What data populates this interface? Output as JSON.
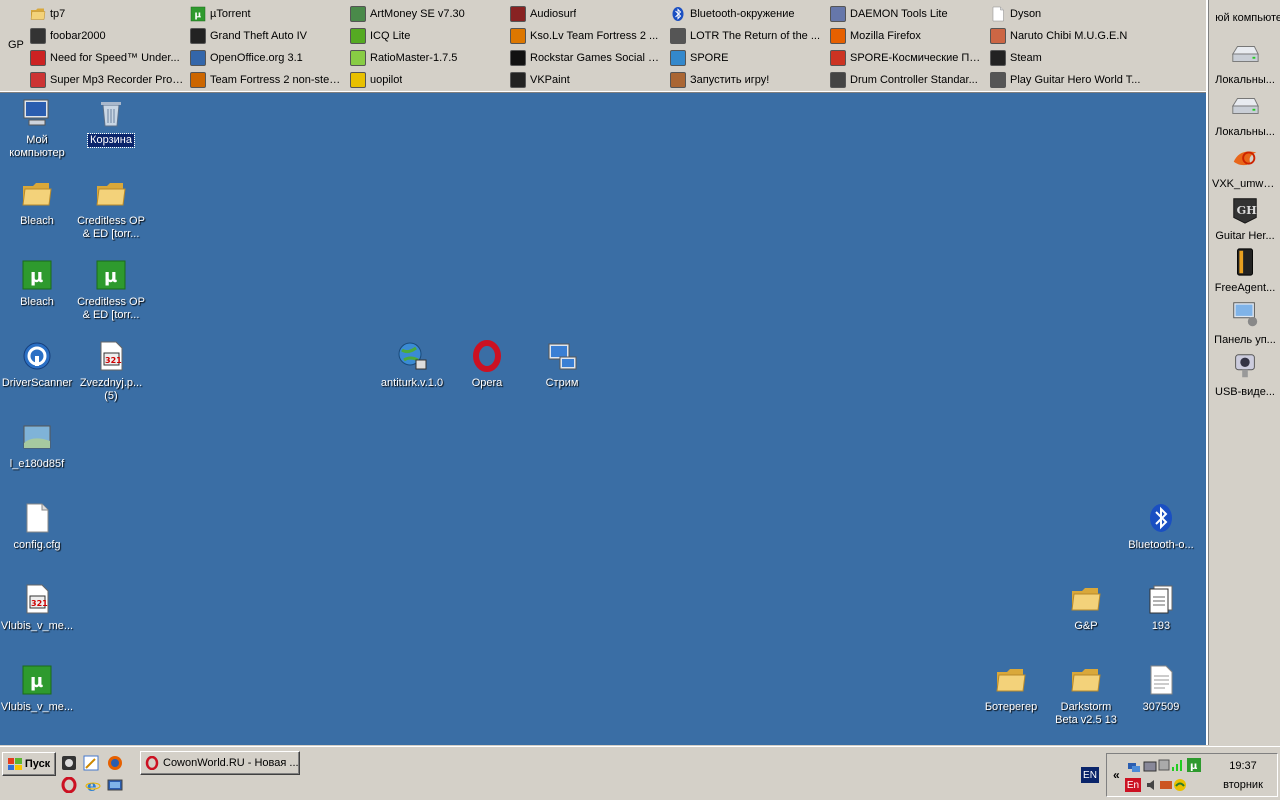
{
  "toolbar": {
    "gp_label": "GP",
    "items": [
      {
        "label": "tp7",
        "icon": "folder-icon",
        "color": "#e8c25a"
      },
      {
        "label": "foobar2000",
        "icon": "foobar-icon",
        "color": "#333333"
      },
      {
        "label": "Need for Speed™ Under...",
        "icon": "nfs-icon",
        "color": "#cc2222"
      },
      {
        "label": "Super Mp3 Recorder Prof...",
        "icon": "recorder-icon",
        "color": "#cc3333"
      },
      {
        "label": "µTorrent",
        "icon": "utorrent-icon",
        "color": "#2e9a2e"
      },
      {
        "label": "Grand Theft Auto IV",
        "icon": "gta-icon",
        "color": "#222222"
      },
      {
        "label": "OpenOffice.org 3.1",
        "icon": "openoffice-icon",
        "color": "#3366aa"
      },
      {
        "label": "Team Fortress 2 non-steam",
        "icon": "tf2-icon",
        "color": "#cc6600"
      },
      {
        "label": "ArtMoney SE v7.30",
        "icon": "artmoney-icon",
        "color": "#4a8a4a"
      },
      {
        "label": "ICQ Lite",
        "icon": "icq-icon",
        "color": "#55aa22"
      },
      {
        "label": "RatioMaster-1.7.5",
        "icon": "ratiomaster-icon",
        "color": "#88cc44"
      },
      {
        "label": "uopilot",
        "icon": "uopilot-icon",
        "color": "#e8c000"
      },
      {
        "label": "Audiosurf",
        "icon": "audiosurf-icon",
        "color": "#882222"
      },
      {
        "label": "Kso.Lv Team Fortress 2 ...",
        "icon": "halflife-icon",
        "color": "#dd7700"
      },
      {
        "label": "Rockstar Games Social Club",
        "icon": "rockstar-icon",
        "color": "#111111"
      },
      {
        "label": "VKPaint",
        "icon": "vkpaint-icon",
        "color": "#222222"
      },
      {
        "label": "Bluetooth-окружение",
        "icon": "bluetooth-icon",
        "color": "#1a4fc2"
      },
      {
        "label": "LOTR The Return of the ...",
        "icon": "lotr-icon",
        "color": "#555555"
      },
      {
        "label": "SPORE",
        "icon": "spore-icon",
        "color": "#3388cc"
      },
      {
        "label": "Запустить игру!",
        "icon": "game-icon",
        "color": "#aa6633"
      },
      {
        "label": "DAEMON Tools Lite",
        "icon": "daemon-icon",
        "color": "#6677aa"
      },
      {
        "label": "Mozilla Firefox",
        "icon": "firefox-icon",
        "color": "#e66000"
      },
      {
        "label": "SPORE-Космические Пр...",
        "icon": "spore-space-icon",
        "color": "#cc3322"
      },
      {
        "label": "Drum Controller Standar...",
        "icon": "drum-icon",
        "color": "#444444"
      },
      {
        "label": "Dyson",
        "icon": "file-icon",
        "color": "#ffffff"
      },
      {
        "label": "Naruto Chibi M.U.G.E.N",
        "icon": "naruto-icon",
        "color": "#cc6644"
      },
      {
        "label": "Steam",
        "icon": "steam-icon",
        "color": "#222222"
      },
      {
        "label": "Play Guitar Hero World T...",
        "icon": "guitarhero-icon",
        "color": "#555555"
      }
    ]
  },
  "rightbar": {
    "title": "юй компьюте",
    "items": [
      {
        "label": "Локальны...",
        "icon": "drive-icon"
      },
      {
        "label": "Локальны...",
        "icon": "drive-icon"
      },
      {
        "label": "VXK_umwx...",
        "icon": "flame-icon"
      },
      {
        "label": "Guitar Her...",
        "icon": "guitarhero-icon"
      },
      {
        "label": "FreeAgent...",
        "icon": "external-drive-icon"
      },
      {
        "label": "Панель уп...",
        "icon": "control-panel-icon"
      },
      {
        "label": "USB-виде...",
        "icon": "webcam-icon"
      }
    ]
  },
  "desktop": {
    "icons": [
      {
        "label": "Мой компьютер",
        "icon": "computer-icon"
      },
      {
        "label": "Корзина",
        "icon": "recycle-bin-icon"
      },
      {
        "label": "Bleach",
        "icon": "folder-icon"
      },
      {
        "label": "Creditless OP & ED [torr...",
        "icon": "folder-icon"
      },
      {
        "label": "Bleach",
        "icon": "utorrent-icon"
      },
      {
        "label": "Creditless OP & ED [torr...",
        "icon": "utorrent-icon"
      },
      {
        "label": "DriverScanner",
        "icon": "driverscanner-icon"
      },
      {
        "label": "Zvezdnyj.p... (5)",
        "icon": "media-file-icon"
      },
      {
        "label": "l_e180d85f",
        "icon": "image-file-icon"
      },
      {
        "label": "config.cfg",
        "icon": "file-icon"
      },
      {
        "label": "Vlubis_v_me...",
        "icon": "media-file-icon"
      },
      {
        "label": "Vlubis_v_me...",
        "icon": "utorrent-icon"
      },
      {
        "label": "antiturk.v.1.0",
        "icon": "network-globe-icon"
      },
      {
        "label": "Opera",
        "icon": "opera-icon"
      },
      {
        "label": "Стрим",
        "icon": "network-computer-icon"
      },
      {
        "label": "Bluetooth-o...",
        "icon": "bluetooth-icon"
      },
      {
        "label": "G&P",
        "icon": "folder-icon"
      },
      {
        "label": "193",
        "icon": "document-stack-icon"
      },
      {
        "label": "Ботерегер",
        "icon": "folder-icon"
      },
      {
        "label": "Darkstorm Beta v2.5 13",
        "icon": "folder-icon"
      },
      {
        "label": "307509",
        "icon": "text-file-icon"
      }
    ]
  },
  "taskbar": {
    "start_label": "Пуск",
    "task_label": "CowonWorld.RU - Новая ...",
    "lang": "EN",
    "tray_lang": "En",
    "clock_time": "19:37",
    "clock_day": "вторник"
  },
  "colors": {
    "desktop": "#3a6ea5",
    "chrome": "#d4d0c8",
    "selection": "#0a246a"
  }
}
